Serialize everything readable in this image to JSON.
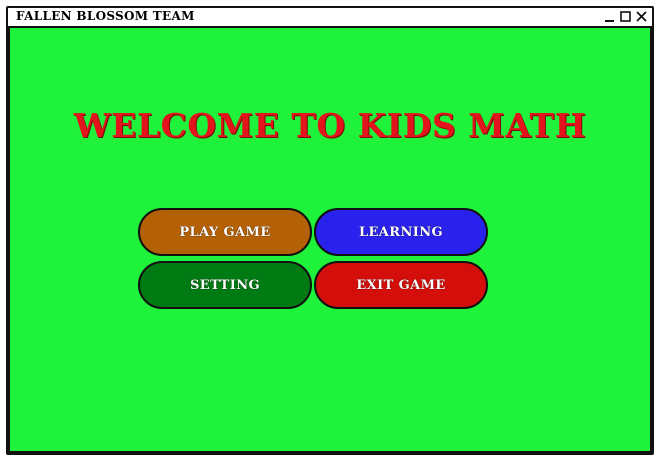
{
  "window": {
    "title": "Fallen Blossom Team",
    "controls": [
      "minimize-icon",
      "maximize-icon",
      "close-icon"
    ]
  },
  "main": {
    "headline": "Welcome to Kids Math",
    "buttons": {
      "play": "Play Game",
      "learning": "Learning",
      "setting": "Setting",
      "exit": "Exit Game"
    }
  },
  "colors": {
    "background": "#1ff23a",
    "headline": "#e3141b",
    "play": "#b46106",
    "learning": "#2a21ec",
    "setting": "#007a12",
    "exit": "#d40e0b"
  }
}
